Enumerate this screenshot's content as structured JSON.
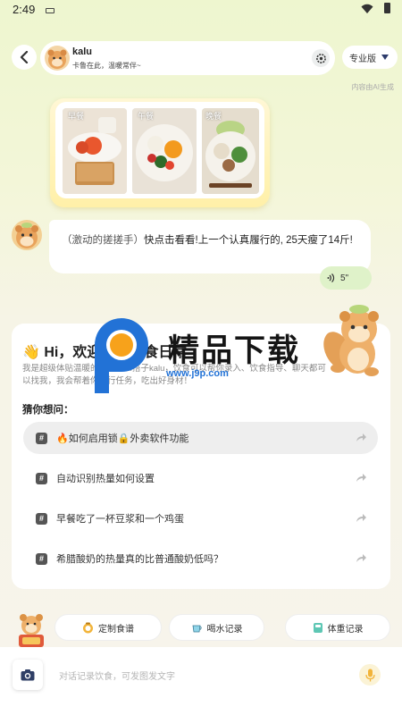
{
  "status_bar": {
    "time": "2:49"
  },
  "header": {
    "name": "kalu",
    "subtitle": "卡鲁在此，温暖常伴~",
    "pro_label": "专业版"
  },
  "ai_note": "内容由AI生成",
  "meals": [
    {
      "label": "早餐"
    },
    {
      "label": "午餐"
    },
    {
      "label": "晚餐"
    }
  ],
  "message": {
    "prefix": "（激动的搓搓手）",
    "text": "快点击看看!上一个认真履行的, 25天瘦了14斤!",
    "voice_duration": "5\""
  },
  "welcome": {
    "title": "👋 Hi，欢迎使用饮食日常",
    "desc": "我是超级体贴温暖的营养师AI搭子kalu，饮食可以帮你录入、饮食指导、聊天都可以找我，我会帮着你执行任务，吃出好身材！",
    "guess_title": "猜你想问：",
    "suggestions": [
      "🔥如何启用锁🔒外卖软件功能",
      "自动识别热量如何设置",
      "早餐吃了一杯豆浆和一个鸡蛋",
      "希腊酸奶的热量真的比普通酸奶低吗？"
    ]
  },
  "watermark": {
    "text": "精品下载",
    "url": "www.j9p.com"
  },
  "quick_actions": [
    {
      "label": "定制食谱",
      "icon": "recipe-icon"
    },
    {
      "label": "喝水记录",
      "icon": "cup-icon"
    },
    {
      "label": "体重记录",
      "icon": "scale-icon"
    }
  ],
  "input": {
    "placeholder": "对话记录饮食，可发图发文字"
  },
  "colors": {
    "accent_green": "#dff2c9",
    "pro_triangle": "#2c3b6b",
    "watermark_blue": "#2272d6",
    "watermark_orange": "#f7a21b"
  }
}
